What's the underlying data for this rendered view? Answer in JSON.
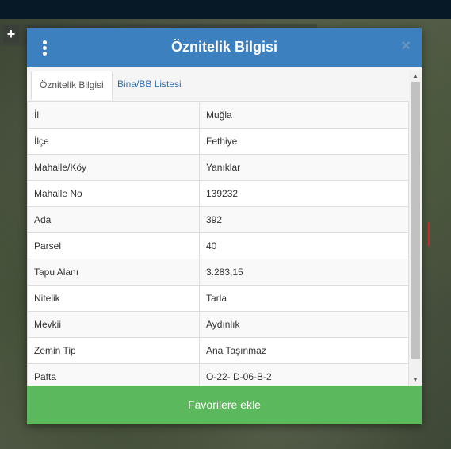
{
  "modal": {
    "title": "Öznitelik Bilgisi",
    "close_label": "×",
    "menu_icon": "kebab-menu-icon"
  },
  "map": {
    "zoom_in_label": "+"
  },
  "tabs": [
    {
      "label": "Öznitelik Bilgisi",
      "active": true
    },
    {
      "label": "Bina/BB Listesi",
      "active": false
    }
  ],
  "attributes": [
    {
      "key": "İl",
      "value": "Muğla"
    },
    {
      "key": "İlçe",
      "value": "Fethiye"
    },
    {
      "key": "Mahalle/Köy",
      "value": "Yanıklar"
    },
    {
      "key": "Mahalle No",
      "value": "139232"
    },
    {
      "key": "Ada",
      "value": "392"
    },
    {
      "key": "Parsel",
      "value": "40"
    },
    {
      "key": "Tapu Alanı",
      "value": "3.283,15"
    },
    {
      "key": "Nitelik",
      "value": "Tarla"
    },
    {
      "key": "Mevkii",
      "value": "Aydınlık"
    },
    {
      "key": "Zemin Tip",
      "value": "Ana Taşınmaz"
    },
    {
      "key": "Pafta",
      "value": "O-22- D-06-B-2"
    }
  ],
  "footer": {
    "favorite_button_label": "Favorilere ekle"
  },
  "colors": {
    "header": "#3d80c0",
    "favorite_button": "#5cb85c",
    "tab_link": "#2f6fb0"
  }
}
